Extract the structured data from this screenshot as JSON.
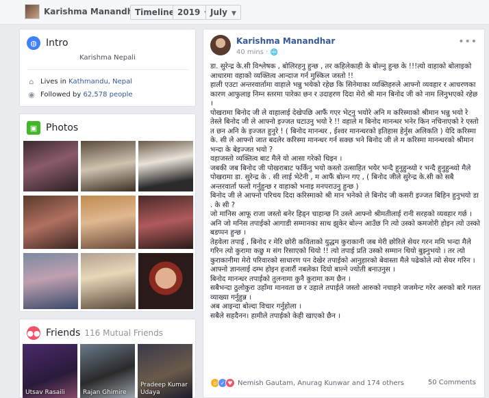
{
  "topbar": {
    "name": "Karishma Manandhar",
    "dropdowns": [
      {
        "label": "Timeline"
      },
      {
        "label": "2019"
      },
      {
        "label": "July"
      }
    ],
    "caret": "▼"
  },
  "intro": {
    "title": "Intro",
    "bio": "Karishma Nepali",
    "lives_prefix": "Lives in",
    "lives_place": "Kathmandu, Nepal",
    "followed_prefix": "Followed by",
    "followers": "62,578 people"
  },
  "photos": {
    "title": "Photos"
  },
  "friends": {
    "title": "Friends",
    "mutual": "116 Mutual Friends",
    "people": [
      {
        "name": "Utsav Rasaili"
      },
      {
        "name": "Rajan Ghimire"
      },
      {
        "name": "Pradeep Kumar Udaya"
      }
    ]
  },
  "post": {
    "author": "Karishma Manandhar",
    "time": "40 mins",
    "globe": "🌐",
    "menu": "•••",
    "paragraphs": [
      "डा. सुरेन्द्र के.सी विश्लेषक , बोलिरहनु हुन्छ , तर कहिलेकाही के बोल्नु हुन्छ के !!!त्यो वाहाको बोलाइको आधारमा वहाको व्यक्तित्व आन्दाज गर्न मुस्किल जस्तो !!",
      "हाली एउटा अन्तरवार्तामा वाहाले भन्नु भयेको रहेछ कि सिनेमाका व्यक्तिहरुले आफ्नो व्यवहार र आचरणका कारण आफुलाइ निम्न स्तरमा पारेका छन र उदाहरण दिदा मेरो श्री मान बिनोद जी को नाम लिनुभएको रहेछ ।",
      "पोखरामा बिनोद जी ले वाहालाई देखेपछि आफैं गएर भेट्नु भयोरे अनि म करिस्माको श्रीमान भन्नु भयो रे तेस्ले बिनोद जी ले आफ्नो इज्जत घटाउनु भयो रे !! वहाले म बिनोद मानन्धर भनेर किन नचिनाएको रे एस्तो त छन अनि के इज्जत हुनुरे ! ( बिनोद मानन्धर , ईश्वर मानन्धरको इतिहास हेर्नुस अलिकति ) येदि करिस्मा के. सी ले आफ्नो जात बदलेर करिस्मा मानन्धर गर्न सक्छ भने बिनोद जी ले म करिस्मा मानन्धरको श्रीमान भन्दा के बेइज्जत भयो ?",
      "वहाजस्तो व्यक्तित्व बाट मैले यो आसा गरेको थिइन ।",
      "जबकी जब बिनोद जी पोखराबाट फर्किनु भयो कस्तो उत्साहित भयेर भन्दै हुनुहुन्थ्यो र भन्दै हुनुहुन्थ्यो मैले पोखरामा डा. सुरेन्द्र के . सी लाई भेटेनी , म आफैं बोल्न गए , ( बिनोद जीले सुरेन्द्र के.सी को सबै अन्तरवार्ता फलो गर्नुहुन्छ र वाहाको भनाइ मनपराउनु हुन्छ )",
      "बिनोद जी ले आफ्नो परिचय दिदा करिस्माको श्री मान भनेको ले बिनोद जी कसरी इज्जत बिहिन हुनुभयो डा . के सी ?",
      "जो मानिस आफू राजा जस्तो बनेर हिड्न चाहान्छ नि उस्ले आफ्नो श्रीमतीलाई रानी सरहको व्यवहार गर्छ ।",
      "अनि जो मनिस तपाईको आगाडी सम्मानका साथ झुकेर बोल्न आउँछ नि त्यो उस्को कमजोरी होइन त्यो उस्को बडप्पन हुन्छ ।",
      "तेहवेला तपाई , बिनोद र मेरि छोरी कविताको युद्धम कुराकानी जब मेरी छोरिले सेयर गरन ममि भन्दा मैले गरिन त्यो कुरामा कछु म संग रिसाएको थियो !! त्यो तपाई प्रति उस्को सम्मान थियो बुझ्नुभयो । तर त्यो कुराकानीमा मेरो परिवारको साधारण पन देखेर तपाईको आनुहारको बेवास्ता मैले पढेकोले त्यो सेयर गरिन ।",
      "आफ्नो ज्ञानलाई दम्भ होइन हजारौं नबलेका दियो बाल्ने ज्योती बनाउनुस ।",
      "बिनोद मानन्धर तपाईको तुलनामा कुनै कुरामा कम छैन ।",
      "सबैभन्दा ठुलोकुरा उहाँमा मानवता छ र उहाले तपाईले जस्तो आरुको नचाहने जजमेन्ट गरेर अरुको बारे गलत व्याख्या गर्नुहुन्न ।",
      "अब आइन्दा बोल्दा विचार गर्नुहोला ।",
      "सबैले सहदैनन। हामीले तपाईको केही खाएको छैन ।"
    ],
    "reactions_text": "Nemish Gautam, Anurag Kunwar and 174 others",
    "comments": "50 Comments"
  },
  "colors": {
    "fb_blue": "#365899",
    "globe_icon": "#4080ff",
    "photos_icon": "#42b72a",
    "friends_icon": "#f35369",
    "background": "#e9ebee"
  }
}
